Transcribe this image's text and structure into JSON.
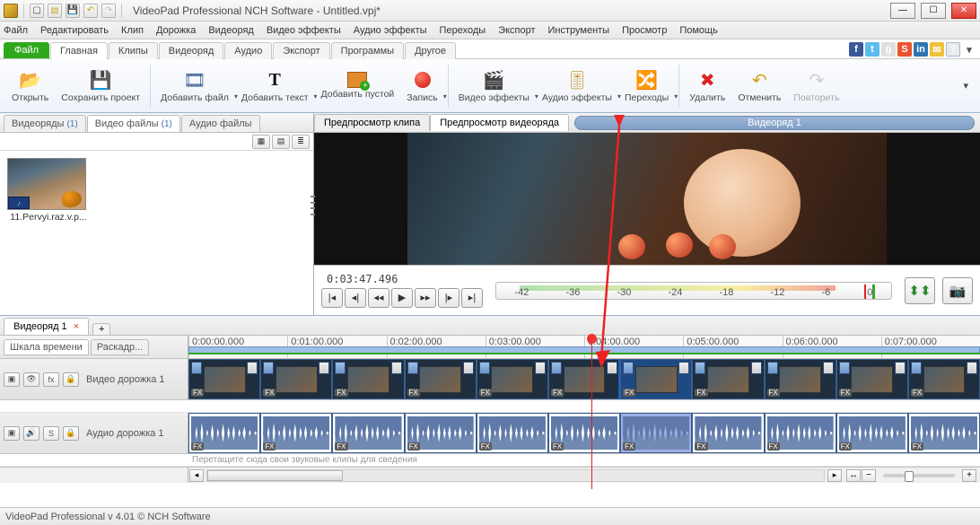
{
  "app": {
    "title": "VideoPad Professional NCH Software - Untitled.vpj*",
    "status": "VideoPad Professional v 4.01  © NCH Software"
  },
  "menu": [
    "Файл",
    "Редактировать",
    "Клип",
    "Дорожка",
    "Видеоряд",
    "Видео эффекты",
    "Аудио эффекты",
    "Переходы",
    "Экспорт",
    "Инструменты",
    "Просмотр",
    "Помощь"
  ],
  "ribbon_tabs": {
    "file": "Файл",
    "items": [
      "Главная",
      "Клипы",
      "Видеоряд",
      "Аудио",
      "Экспорт",
      "Программы",
      "Другое"
    ],
    "active": 0
  },
  "ribbon": {
    "open": "Открыть",
    "save": "Сохранить проект",
    "add_file": "Добавить файл",
    "add_text": "Добавить текст",
    "add_blank": "Добавить пустой",
    "record": "Запись",
    "vfx": "Видео эффекты",
    "afx": "Аудио эффекты",
    "trans": "Переходы",
    "delete": "Удалить",
    "undo": "Отменить",
    "redo": "Повторить"
  },
  "bins": {
    "tabs": [
      {
        "label": "Видеоряды",
        "count": "(1)"
      },
      {
        "label": "Видео файлы",
        "count": "(1)"
      },
      {
        "label": "Аудио файлы",
        "count": ""
      }
    ],
    "active": 1,
    "clip_name": "11.Pervyi.raz.v.p..."
  },
  "preview": {
    "tabs": [
      "Предпросмотр клипа",
      "Предпросмотр видеоряда"
    ],
    "active": 1,
    "sequence_title": "Видеоряд 1",
    "time": "0:03:47.496",
    "meter_ticks": [
      "-42",
      "-36",
      "-30",
      "-24",
      "-18",
      "-12",
      "-6",
      "0"
    ]
  },
  "sequence_tabs": {
    "name": "Видеоряд 1",
    "add": "+"
  },
  "timeline": {
    "modes": [
      "Шкала времени",
      "Раскадр..."
    ],
    "ticks": [
      "0:00:00.000",
      "0:01:00.000",
      "0:02:00.000",
      "0:03:00.000",
      "0:04:00.000",
      "0:05:00.000",
      "0:06:00.000",
      "0:07:00.000"
    ],
    "video_track": "Видео дорожка 1",
    "audio_track": "Аудио дорожка 1",
    "drag_hint_audio": "Перетащите сюда свои звуковые клипы для сведения",
    "fx": "FX"
  }
}
